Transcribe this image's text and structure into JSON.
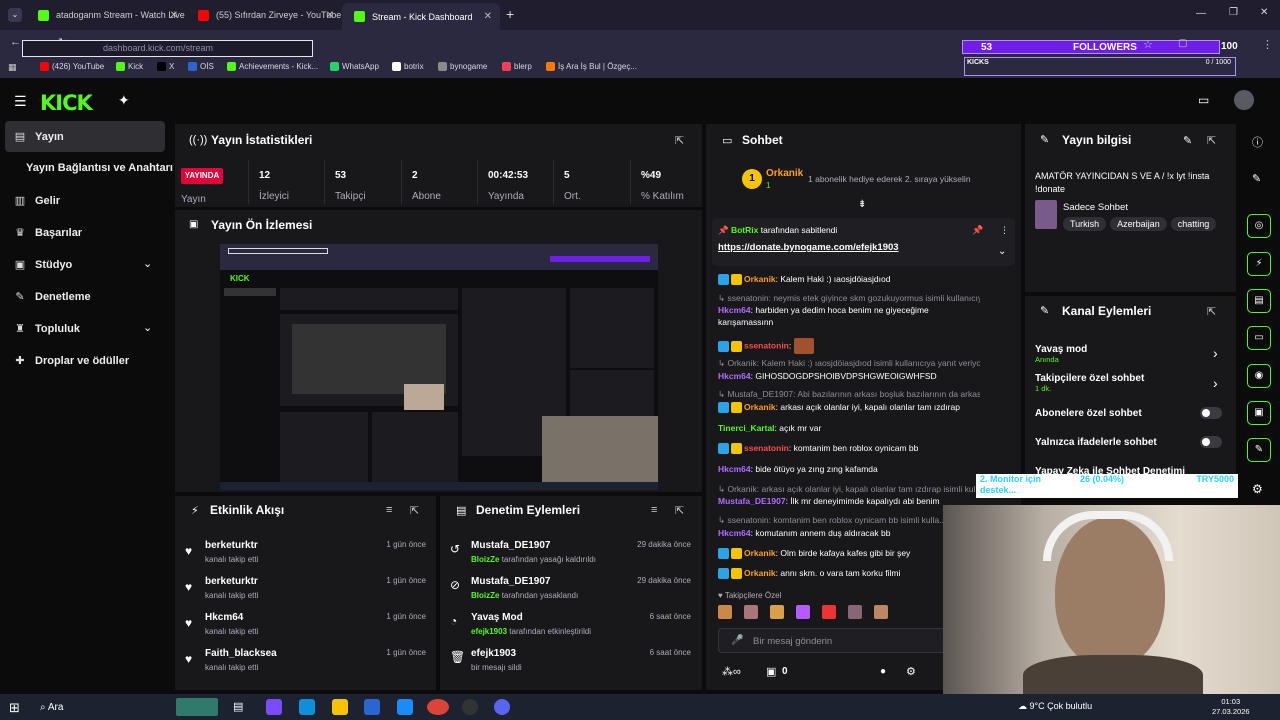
{
  "browser": {
    "tabs": [
      {
        "label": "atadoganm Stream - Watch Live"
      },
      {
        "label": "(55) Sıfırdan Zirveye - YouTube"
      },
      {
        "label": "Stream - Kick Dashboard"
      }
    ],
    "new_tab": "+",
    "url": "dashboard.kick.com/stream",
    "bookmarks": [
      "(426) YouTube",
      "Kick",
      "X",
      "OİS",
      "Achievements - Kick...",
      "WhatsApp",
      "botrix",
      "bynogame",
      "blerp",
      "İş Ara İş Bul | Özgeç..."
    ]
  },
  "overlay": {
    "followers_count": "53",
    "followers_label": "FOLLOWERS",
    "followers_goal": "100",
    "kicks_label": "KICKS",
    "kicks_value": "0 / 1000",
    "monitor_text": "2. Monitor için destek...",
    "monitor_value": "26 (0.04%)",
    "monitor_goal": "TRY5000"
  },
  "sidebar": {
    "items": [
      {
        "label": "Yayın"
      },
      {
        "label": "Yayın Bağlantısı ve Anahtarı"
      },
      {
        "label": "Gelir"
      },
      {
        "label": "Başarılar"
      },
      {
        "label": "Stüdyo"
      },
      {
        "label": "Denetleme"
      },
      {
        "label": "Topluluk"
      },
      {
        "label": "Droplar ve ödüller"
      }
    ]
  },
  "stats": {
    "title": "Yayın İstatistikleri",
    "live_badge": "YAYINDA",
    "live_label": "Yayın",
    "items": [
      {
        "value": "12",
        "label": "İzleyici"
      },
      {
        "value": "53",
        "label": "Takipçi"
      },
      {
        "value": "2",
        "label": "Abone"
      },
      {
        "value": "00:42:53",
        "label": "Yayında"
      },
      {
        "value": "5",
        "label": "Ort."
      },
      {
        "value": "%49",
        "label": "% Katılım"
      }
    ]
  },
  "preview": {
    "title": "Yayın Ön İzlemesi"
  },
  "activity": {
    "title": "Etkinlik Akışı",
    "items": [
      {
        "name": "berketurktr",
        "sub": "kanalı takip etti",
        "time": "1 gün önce"
      },
      {
        "name": "berketurktr",
        "sub": "kanalı takip etti",
        "time": "1 gün önce"
      },
      {
        "name": "Hkcm64",
        "sub": "kanalı takip etti",
        "time": "1 gün önce"
      },
      {
        "name": "Faith_blacksea",
        "sub": "kanalı takip etti",
        "time": "1 gün önce"
      }
    ]
  },
  "moderation": {
    "title": "Denetim Eylemleri",
    "items": [
      {
        "name": "Mustafa_DE1907",
        "by": "BloizZe",
        "action": "tarafından yasağı kaldırıldı",
        "time": "29 dakika önce"
      },
      {
        "name": "Mustafa_DE1907",
        "by": "BloizZe",
        "action": "tarafından yasaklandı",
        "time": "29 dakika önce"
      },
      {
        "name": "Yavaş Mod",
        "by": "efejk1903",
        "action": "tarafından etkinleştirildi",
        "time": "6 saat önce"
      },
      {
        "name": "efejk1903",
        "by": "",
        "action": "bir mesajı sildi",
        "time": "6 saat önce"
      }
    ]
  },
  "chat": {
    "title": "Sohbet",
    "top_user": "Orkanik",
    "top_rank": "1",
    "top_count": "1",
    "gift_text": "1 abonelik hediye ederek 2. sıraya yükselin",
    "pinned_by": "BotRix",
    "pinned_suffix": "tarafından sabitlendi",
    "pinned_link": "https://donate.bynogame.com/efejk1903",
    "messages": [
      {
        "user": "Orkanik",
        "text": "Kalem Haki :) ıaosjdöiasjdıod",
        "color": "#ff9f1a"
      },
      {
        "sys": "ssenatonin: neymis etek giyince skm gozukuyormus isimli kullanıcıya y..."
      },
      {
        "user": "Hkcm64",
        "text": "harbiden ya dedim hoca benim ne giyeceğime karışamassınn",
        "color": "#b26bff"
      },
      {
        "user": "ssenatonin",
        "text": "",
        "color": "#ff4b4b"
      },
      {
        "sys": "Orkanik: Kalem Haki :) ıaosjdöiasjdıod isimli kullanıcıya yanıt veriyor"
      },
      {
        "user": "Hkcm64",
        "text": "GIHOSDOGDPSHOIBVDPSHGWEOIGWHFSD",
        "color": "#b26bff"
      },
      {
        "sys": "Mustafa_DE1907: Abi bazılarının arkası boşluk bazılarının da arkası dol..."
      },
      {
        "user": "Orkanik",
        "text": "arkası açık olanlar iyi, kapalı olanlar tam ızdırap",
        "color": "#ff9f1a"
      },
      {
        "user": "Tinerci_Kartal",
        "text": "açık mr var",
        "color": "#53fc18"
      },
      {
        "user": "ssenatonin",
        "text": "komtanim ben roblox oynicam bb",
        "color": "#ff4b4b"
      },
      {
        "user": "Hkcm64",
        "text": "bide ötüyo ya zıng zıng kafamda",
        "color": "#b26bff"
      },
      {
        "sys": "Orkanik: arkası açık olanlar iyi, kapalı olanlar tam ızdırap isimli kul..."
      },
      {
        "user": "Mustafa_DE1907",
        "text": "İlk mr deneyimimde kapalıydı abi benim",
        "color": "#b26bff"
      },
      {
        "sys": "ssenatonin: komtanim ben roblox oynicam bb isimli kulla..."
      },
      {
        "user": "Hkcm64",
        "text": "komutanım annem duş aldıracak bb",
        "color": "#b26bff"
      },
      {
        "user": "Orkanik",
        "text": "Olm birde kafaya kafes gibi bir şey",
        "color": "#ff9f1a"
      },
      {
        "user": "Orkanik",
        "text": "annı skm. o vara tam korku filmi",
        "color": "#ff9f1a"
      }
    ],
    "followers_only": "Takipçilere Özel",
    "placeholder": "Bir mesaj gönderin",
    "points": "0"
  },
  "info": {
    "title": "Yayın bilgisi",
    "stream_title": "AMATÖR YAYINCIDAN S VE A / !x lyt !insta !donate",
    "category": "Sadece Sohbet",
    "tags": [
      "Turkish",
      "Azerbaijan",
      "chatting"
    ]
  },
  "channel_actions": {
    "title": "Kanal Eylemleri",
    "items": [
      {
        "label": "Yavaş mod",
        "sub": "Anında"
      },
      {
        "label": "Takipçilere özel sohbet",
        "sub": "1 dk."
      },
      {
        "label": "Abonelere özel sohbet",
        "sub": ""
      },
      {
        "label": "Yalnızca ifadelerle sohbet",
        "sub": ""
      },
      {
        "label": "Yapay Zeka ile Sohbet Denetimi",
        "sub": ""
      }
    ]
  },
  "taskbar": {
    "search": "Ara",
    "weather": "9°C Çok bulutlu",
    "time": "01:03",
    "date": "27.03.2026"
  },
  "colors": {
    "accent": "#53fc18",
    "panel": "#18181b",
    "live": "#e1003c"
  }
}
